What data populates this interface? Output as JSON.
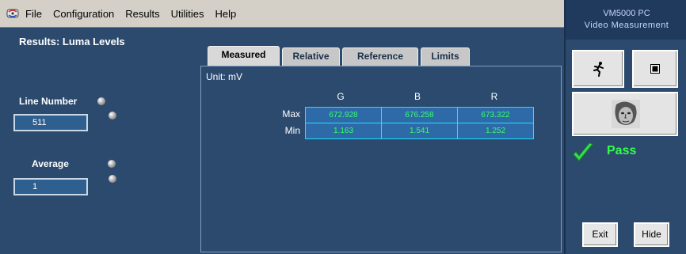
{
  "menu": {
    "items": [
      "File",
      "Configuration",
      "Results",
      "Utilities",
      "Help"
    ]
  },
  "results": {
    "title": "Results: Luma Levels"
  },
  "sidebar": {
    "line_number_label": "Line Number",
    "line_number_value": "511",
    "average_label": "Average",
    "average_value": "1"
  },
  "tabs": [
    {
      "label": "Measured",
      "active": true
    },
    {
      "label": "Relative",
      "active": false
    },
    {
      "label": "Reference",
      "active": false
    },
    {
      "label": "Limits",
      "active": false
    }
  ],
  "panel": {
    "unit_label": "Unit: mV",
    "columns": [
      "G",
      "B",
      "R"
    ],
    "rows": [
      {
        "label": "Max",
        "values": [
          "672.928",
          "676.258",
          "673.322"
        ]
      },
      {
        "label": "Min",
        "values": [
          "1.163",
          "1.541",
          "1.252"
        ]
      }
    ]
  },
  "right_panel": {
    "title": "VM5000 PC",
    "subtitle": "Video Measurement",
    "status": "Pass",
    "exit_label": "Exit",
    "hide_label": "Hide"
  },
  "colors": {
    "background": "#2b4a6e",
    "value_text": "#36ff6a",
    "cell_border": "#20e0ff",
    "pass": "#34ff4a"
  },
  "icons": {
    "app": "app-icon",
    "run": "running-man-icon",
    "stop": "stop-icon",
    "image": "face-image-icon",
    "check": "checkmark-icon"
  }
}
